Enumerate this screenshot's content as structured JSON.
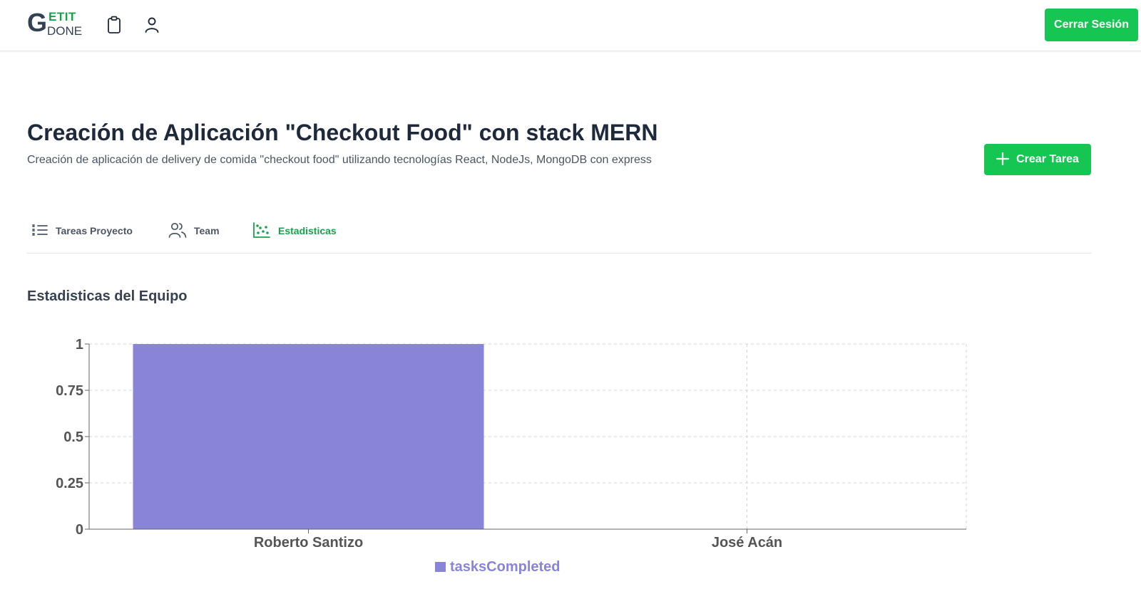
{
  "header": {
    "logo": {
      "letter": "G",
      "top": "ETIT",
      "bottom": "DONE"
    },
    "icons": [
      "clipboard-icon",
      "user-icon"
    ],
    "logout_label": "Cerrar Sesión"
  },
  "project": {
    "title": "Creación de Aplicación \"Checkout Food\" con stack MERN",
    "description": "Creación de aplicación de delivery de comida \"checkout food\" utilizando tecnologías React, NodeJs, MongoDB con express",
    "create_task_label": "Crear Tarea"
  },
  "tabs": [
    {
      "label": "Tareas Proyecto",
      "icon": "list-icon",
      "active": false
    },
    {
      "label": "Team",
      "icon": "users-icon",
      "active": false
    },
    {
      "label": "Estadisticas",
      "icon": "chart-icon",
      "active": true
    }
  ],
  "stats": {
    "section_title": "Estadisticas del Equipo"
  },
  "colors": {
    "brand_green": "#16c653",
    "active_tab": "#16a34a",
    "bar": "#8884d8"
  },
  "chart_data": {
    "type": "bar",
    "categories": [
      "Roberto Santizo",
      "José Acán"
    ],
    "series": [
      {
        "name": "tasksCompleted",
        "values": [
          1,
          0
        ]
      }
    ],
    "yticks": [
      "0",
      "0.25",
      "0.5",
      "0.75",
      "1"
    ],
    "ylim": [
      0,
      1
    ],
    "grid": true,
    "legend": "bottom"
  }
}
